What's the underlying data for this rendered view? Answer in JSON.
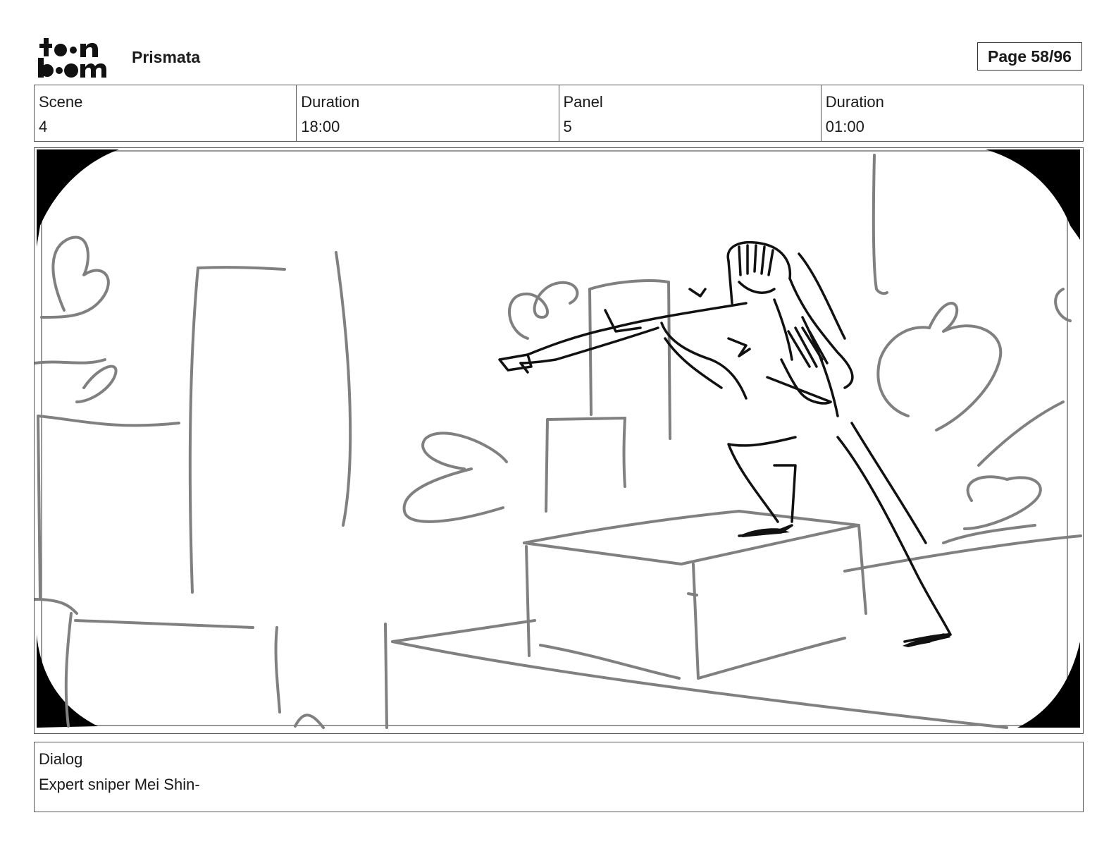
{
  "header": {
    "logo_text": "toon boom",
    "project": "Prismata",
    "page_label": "Page 58/96"
  },
  "info": {
    "scene_label": "Scene",
    "scene_value": "4",
    "scene_duration_label": "Duration",
    "scene_duration_value": "18:00",
    "panel_label": "Panel",
    "panel_value": "5",
    "panel_duration_label": "Duration",
    "panel_duration_value": "01:00"
  },
  "dialog": {
    "label": "Dialog",
    "text": "Expert sniper Mei Shin-"
  },
  "colors": {
    "ink": "#111111",
    "pencil": "#808080",
    "border": "#555555"
  }
}
